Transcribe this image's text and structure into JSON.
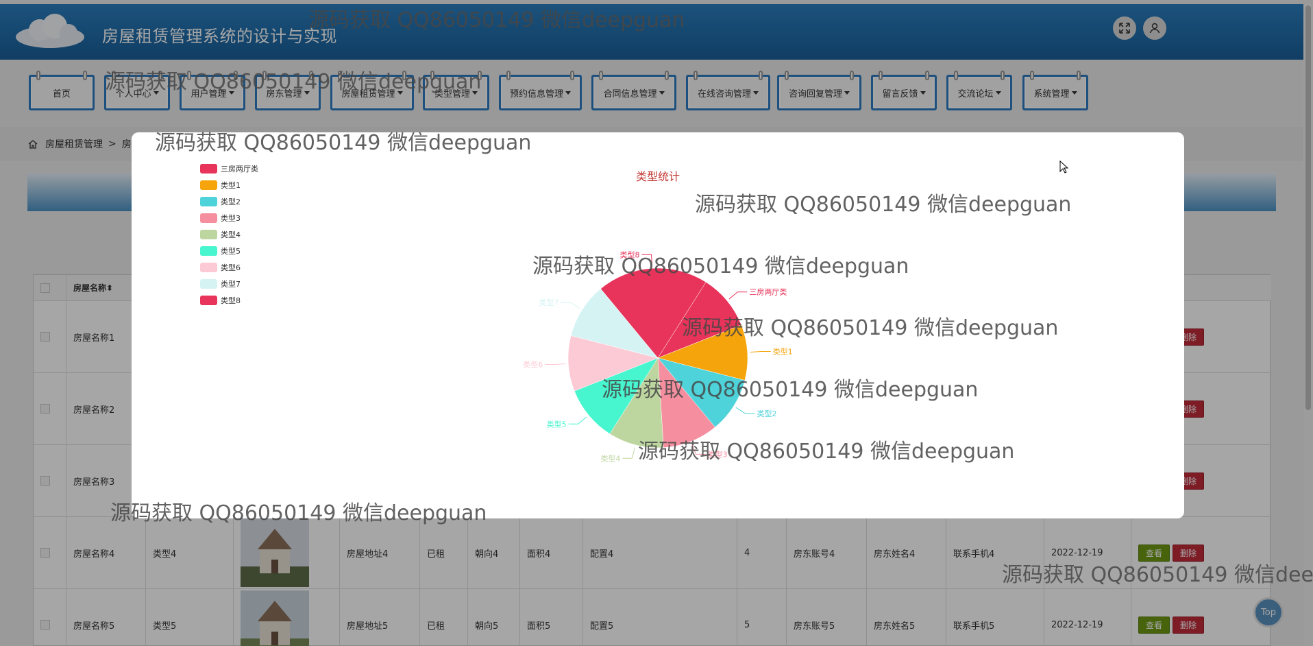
{
  "header": {
    "title": "房屋租赁管理系统的设计与实现"
  },
  "nav": {
    "items": [
      {
        "label": "首页",
        "dropdown": false
      },
      {
        "label": "个人中心",
        "dropdown": true
      },
      {
        "label": "用户管理",
        "dropdown": true
      },
      {
        "label": "房东管理",
        "dropdown": true
      },
      {
        "label": "房屋租赁管理",
        "dropdown": true
      },
      {
        "label": "类型管理",
        "dropdown": true
      },
      {
        "label": "预约信息管理",
        "dropdown": true
      },
      {
        "label": "合同信息管理",
        "dropdown": true
      },
      {
        "label": "在线咨询管理",
        "dropdown": true
      },
      {
        "label": "咨询回复管理",
        "dropdown": true
      },
      {
        "label": "留言反馈",
        "dropdown": true
      },
      {
        "label": "交流论坛",
        "dropdown": true
      },
      {
        "label": "系统管理",
        "dropdown": true
      }
    ]
  },
  "breadcrumb": {
    "root": "房屋租赁管理",
    "separator": ">",
    "current": "房"
  },
  "table": {
    "header_name": "房屋名称",
    "rows": [
      {
        "name": "房屋名称1"
      },
      {
        "name": "房屋名称2"
      },
      {
        "name": "房屋名称3"
      },
      {
        "name": "房屋名称4",
        "type": "类型4",
        "address": "房屋地址4",
        "status": "已租",
        "orientation": "朝向4",
        "area": "面积4",
        "config": "配置4",
        "num": "4",
        "landlord_account": "房东账号4",
        "landlord_name": "房东姓名4",
        "phone": "联系手机4",
        "date": "2022-12-19"
      },
      {
        "name": "房屋名称5",
        "type": "类型5",
        "address": "房屋地址5",
        "status": "已租",
        "orientation": "朝向5",
        "area": "面积5",
        "config": "配置5",
        "num": "5",
        "landlord_account": "房东账号5",
        "landlord_name": "房东姓名5",
        "phone": "联系手机5",
        "date": "2022-12-19"
      }
    ],
    "view_label": "查看",
    "delete_label": "删除"
  },
  "top_button": "Top",
  "watermark": "源码获取 QQ86050149 微信deepguan",
  "chart_data": {
    "type": "pie",
    "title": "类型统计",
    "categories": [
      "三房两厅类",
      "类型1",
      "类型2",
      "类型3",
      "类型4",
      "类型5",
      "类型6",
      "类型7",
      "类型8"
    ],
    "values": [
      1,
      1,
      1,
      1,
      1,
      1,
      1,
      1,
      2
    ],
    "colors": [
      "#e8345a",
      "#f5a40c",
      "#4dd3d9",
      "#f58fa0",
      "#bdd6a0",
      "#47f5ce",
      "#fccad4",
      "#d6f3f4",
      "#e8345a"
    ],
    "legend_position": "top-left"
  }
}
